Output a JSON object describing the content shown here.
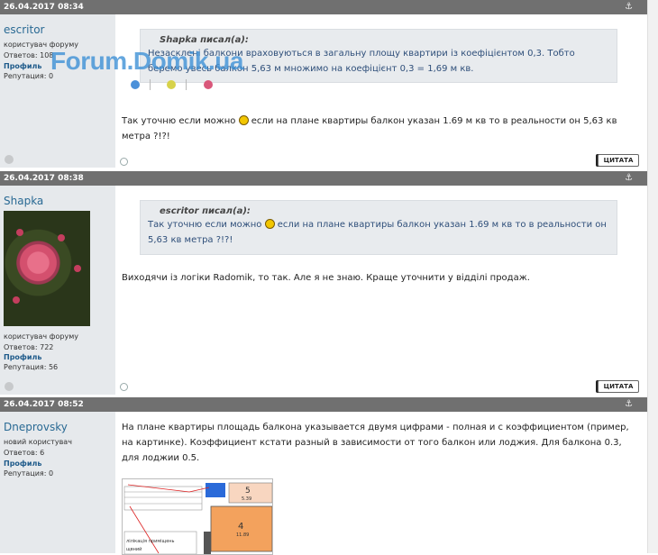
{
  "watermark": "Forum.Domik.ua",
  "posts": [
    {
      "date": "26.04.2017 08:34",
      "anchor": "⚓",
      "user": {
        "name": "escritor",
        "role": "користувач форуму",
        "answers": "Ответов: 108",
        "profile": "Профиль",
        "reputation": "Репутация:    0"
      },
      "quote": {
        "author": "Shapka писал(а):",
        "text": "Незасклені балкони враховуються в загальну площу квартири із коефіцієнтом 0,3. Тобто беремо увесь балкон 5,63 м множимо на коефіцієнт 0,3 = 1,69 м кв."
      },
      "text_before_smiley": "Так уточню если можно ",
      "text_after_smiley": " если на плане квартиры балкон указан 1.69 м кв то в реальности он 5,63 кв метра ?!?!",
      "cite": "ЦИТАТА"
    },
    {
      "date": "26.04.2017 08:38",
      "anchor": "⚓",
      "user": {
        "name": "Shapka",
        "role": "користувач форуму",
        "answers": "Ответов: 722",
        "profile": "Профиль",
        "reputation": "Репутация:    56"
      },
      "quote": {
        "author": "escritor писал(а):",
        "text_before_smiley": "Так уточню если можно ",
        "text_after_smiley": " если на плане квартиры балкон указан 1.69 м кв то в реальности он 5,63 кв метра ?!?!"
      },
      "text": "Виходячи із логіки Radomik, то так. Але я не знаю. Краще уточнити у відділі продаж.",
      "cite": "ЦИТАТА"
    },
    {
      "date": "26.04.2017 08:52",
      "anchor": "⚓",
      "user": {
        "name": "Dneprovsky",
        "role": "новий користувач",
        "answers": "Ответов: 6",
        "profile": "Профиль",
        "reputation": "Репутация:    0"
      },
      "text": "На плане квартиры площадь балкона указывается двумя цифрами - полная и с коэффициентом (пример, на картинке). Коэффициент кстати разный в зависимости от того балкон или лоджия. Для балкона 0.3, для лоджии 0.5.",
      "plan": {
        "room5": "5",
        "room5_area": "5.39",
        "room4": "4",
        "room4_area": "11.89",
        "legend": "лілікація приміщень",
        "legend2": "щвний"
      }
    }
  ],
  "colors": {
    "header_bg": "#707070",
    "sidebar_bg": "#e6e9ec",
    "quote_bg": "#e8ebee",
    "username": "#2a6a94",
    "wm_blue": "#4a90d9",
    "wm_yellow": "#d7d24a",
    "wm_pink": "#d9577a"
  }
}
